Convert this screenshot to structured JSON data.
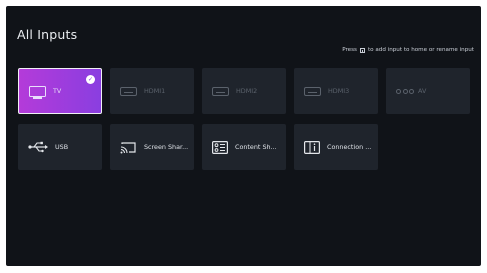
{
  "header": {
    "title": "All Inputs",
    "hint_before": "Press",
    "hint_after": "to add input to home or rename input"
  },
  "inputs": [
    {
      "label": "TV",
      "icon": "tv-icon",
      "state": "selected"
    },
    {
      "label": "HDMI1",
      "icon": "hdmi-icon",
      "state": "disabled"
    },
    {
      "label": "HDMI2",
      "icon": "hdmi-icon",
      "state": "disabled"
    },
    {
      "label": "HDMI3",
      "icon": "hdmi-icon",
      "state": "disabled"
    },
    {
      "label": "AV",
      "icon": "av-icon",
      "state": "disabled"
    },
    {
      "label": "USB",
      "icon": "usb-icon",
      "state": "enabled"
    },
    {
      "label": "Screen Shar...",
      "icon": "screen-share-icon",
      "state": "enabled"
    },
    {
      "label": "Content Sh...",
      "icon": "content-share-icon",
      "state": "enabled"
    },
    {
      "label": "Connection ...",
      "icon": "connection-guide-icon",
      "state": "enabled"
    }
  ],
  "colors": {
    "background": "#101318",
    "tile": "#1f242c",
    "selected_gradient_start": "#b43bd9",
    "selected_gradient_end": "#8a3ee0"
  }
}
